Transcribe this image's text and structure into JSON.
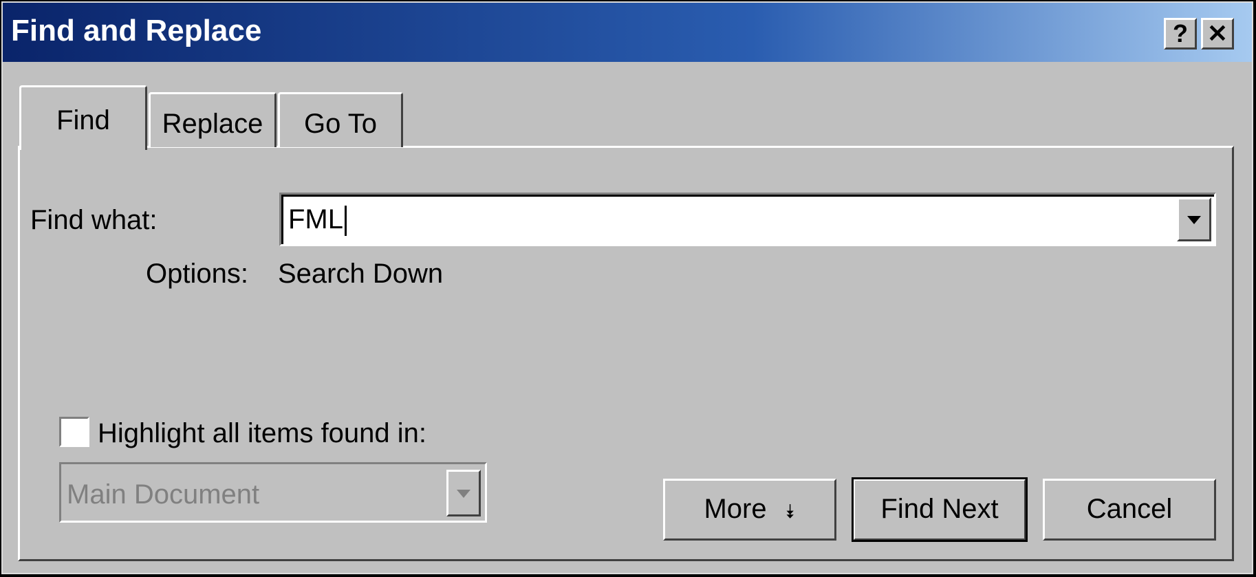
{
  "window": {
    "title": "Find and Replace"
  },
  "titlebar": {
    "help_label": "?",
    "close_label": "✕"
  },
  "tabs": [
    {
      "label": "Find"
    },
    {
      "label": "Replace"
    },
    {
      "label": "Go To"
    }
  ],
  "find": {
    "find_what_label": "Find what:",
    "find_what_value": "FML",
    "options_label": "Options:",
    "options_value": "Search Down"
  },
  "highlight": {
    "checkbox_label": "Highlight all items found in:",
    "checked": false,
    "select_value": "Main Document"
  },
  "buttons": {
    "more_label": "More",
    "more_icon": "double-chevron-down-icon",
    "find_next_label": "Find Next",
    "cancel_label": "Cancel"
  }
}
